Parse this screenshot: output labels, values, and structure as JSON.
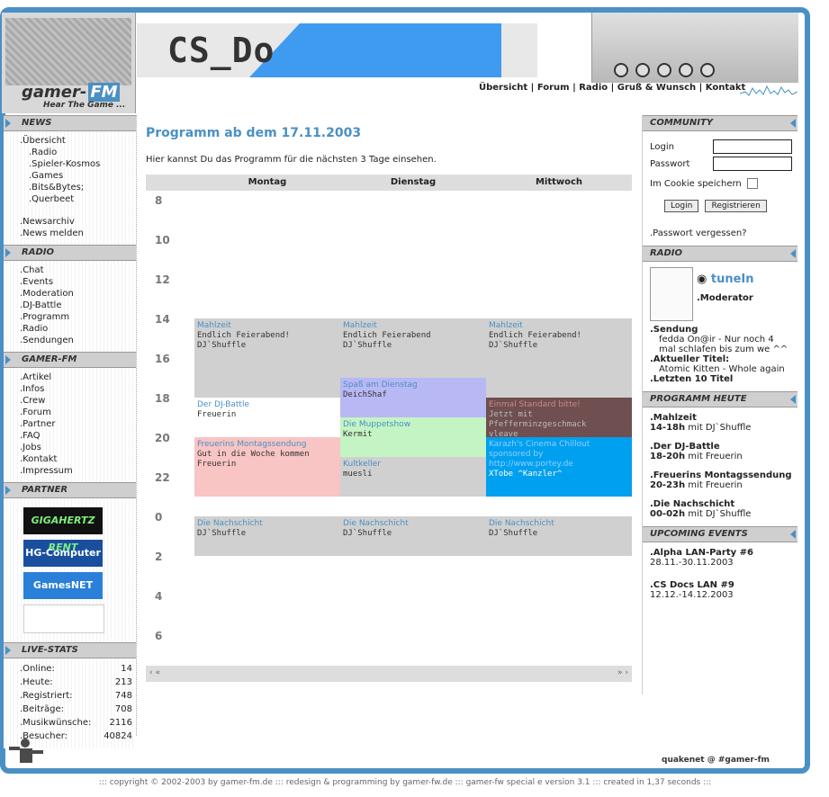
{
  "header": {
    "logo_main": "gamer",
    "logo_fm": "FM",
    "logo_tagline": "Hear The Game ...",
    "banner_text": "CS_Do",
    "nav": [
      "Übersicht",
      "Forum",
      "Radio",
      "Gruß & Wunsch",
      "Kontakt"
    ]
  },
  "left": {
    "news": {
      "title": "NEWS",
      "items": [
        ".Übersicht"
      ],
      "sub": [
        ".Radio",
        ".Spieler-Kosmos",
        ".Games",
        ".Bits&Bytes;",
        ".Querbeet"
      ],
      "extra": [
        ".Newsarchiv",
        ".News melden"
      ]
    },
    "radio": {
      "title": "RADIO",
      "items": [
        ".Chat",
        ".Events",
        ".Moderation",
        ".DJ-Battle",
        ".Programm",
        ".Radio",
        ".Sendungen"
      ]
    },
    "gamerfm": {
      "title": "GAMER-FM",
      "items": [
        ".Artikel",
        ".Infos",
        ".Crew",
        ".Forum",
        ".Partner",
        ".FAQ",
        ".Jobs",
        ".Kontakt",
        ".Impressum"
      ]
    },
    "partner": {
      "title": "PARTNER",
      "logos": [
        "GIGAHERTZ RENT",
        "HG-Computer",
        "GamesNET"
      ]
    },
    "stats": {
      "title": "LIVE-STATS",
      "rows": [
        {
          "label": ".Online:",
          "value": "14"
        },
        {
          "label": ".Heute:",
          "value": "213"
        },
        {
          "label": ".Registriert:",
          "value": "748"
        },
        {
          "label": ".Beiträge:",
          "value": "708"
        },
        {
          "label": ".Musikwünsche:",
          "value": "2116"
        },
        {
          "label": ".Besucher:",
          "value": "40824"
        }
      ]
    }
  },
  "main": {
    "title": "Programm ab dem 17.11.2003",
    "intro": "Hier kannst Du das Programm für die nächsten 3 Tage einsehen.",
    "days": [
      "Montag",
      "Dienstag",
      "Mittwoch"
    ],
    "hours": [
      "8",
      "10",
      "12",
      "14",
      "16",
      "18",
      "20",
      "22",
      "0",
      "2",
      "4",
      "6"
    ],
    "slots": [
      {
        "title": "Mahlzeit",
        "desc": "Endlich Feierabend!\nDJ`Shuffle",
        "day": 0,
        "start": 14,
        "end": 18,
        "color": "#d0d0d0"
      },
      {
        "title": "Mahlzeit",
        "desc": "Endlich Feierabend\nDJ`Shuffle",
        "day": 1,
        "start": 14,
        "end": 17,
        "color": "#d0d0d0"
      },
      {
        "title": "Mahlzeit",
        "desc": "Endlich Feierabend!\nDJ`Shuffle",
        "day": 2,
        "start": 14,
        "end": 18,
        "color": "#d0d0d0"
      },
      {
        "title": "Der DJ-Battle",
        "desc": "Freuerin",
        "day": 0,
        "start": 18,
        "end": 20,
        "color": "#ffffff"
      },
      {
        "title": "Spaß am Dienstag",
        "desc": "DeichShaf",
        "day": 1,
        "start": 17,
        "end": 19,
        "color": "#b8b8f4"
      },
      {
        "title": "Einmal Standard bitte!",
        "desc": "Jetzt mit Pfefferminzgeschmack\nvleave",
        "day": 2,
        "start": 18,
        "end": 20,
        "color": "#6f4f4f"
      },
      {
        "title": "Die Muppetshow",
        "desc": "Kermit",
        "day": 1,
        "start": 19,
        "end": 21,
        "color": "#c4f4c4"
      },
      {
        "title": "Freuerins Montagssendung",
        "desc": "Gut in die Woche kommen\nFreuerin",
        "day": 0,
        "start": 20,
        "end": 23,
        "color": "#f8c4c4"
      },
      {
        "title": "Kultkeller",
        "desc": "muesli",
        "day": 1,
        "start": 21,
        "end": 23,
        "color": "#d0d0d0"
      },
      {
        "title": "Karazh's Cinema Chillout sponsored by http://www.portey.de",
        "desc": "XTobe ^Kanzler^",
        "day": 2,
        "start": 20,
        "end": 23,
        "color": "#00a0f0"
      },
      {
        "title": "Die Nachschicht",
        "desc": "DJ`Shuffle",
        "day": 0,
        "start": 24,
        "end": 26,
        "color": "#d0d0d0"
      },
      {
        "title": "Die Nachschicht",
        "desc": "DJ`Shuffle",
        "day": 1,
        "start": 24,
        "end": 26,
        "color": "#d0d0d0"
      },
      {
        "title": "Die Nachschicht",
        "desc": "DJ`Shuffle",
        "day": 2,
        "start": 24,
        "end": 26,
        "color": "#d0d0d0"
      }
    ],
    "scroll_left": "‹ «",
    "scroll_right": "» ›"
  },
  "right": {
    "community": {
      "title": "COMMUNITY",
      "login_label": "Login",
      "password_label": "Passwort",
      "cookie_label": "Im Cookie speichern",
      "login_button": "Login",
      "register_button": "Registrieren",
      "forgot": ".Passwort vergessen?"
    },
    "radio": {
      "title": "RADIO",
      "tunein": "tuneIn",
      "moderator": ".Moderator",
      "sendung_label": ".Sendung",
      "sendung_text": "fedda On@ir - Nur noch 4 mal schlafen bis zum we ^^",
      "titel_label": ".Aktueller Titel:",
      "titel_text": "Atomic Kitten - Whole again",
      "last10": ".Letzten 10 Titel"
    },
    "today": {
      "title": "PROGRAMM HEUTE",
      "items": [
        {
          "name": ".Mahlzeit",
          "time": "14-18h",
          "by": "mit DJ`Shuffle"
        },
        {
          "name": ".Der DJ-Battle",
          "time": "18-20h",
          "by": "mit Freuerin"
        },
        {
          "name": ".Freuerins Montagssendung",
          "time": "20-23h",
          "by": "mit Freuerin"
        },
        {
          "name": ".Die Nachschicht",
          "time": "00-02h",
          "by": "mit DJ`Shuffle"
        }
      ]
    },
    "events": {
      "title": "UPCOMING EVENTS",
      "items": [
        {
          "name": ".Alpha LAN-Party #6",
          "date": "28.11.-30.11.2003"
        },
        {
          "name": ".CS Docs LAN #9",
          "date": "12.12.-14.12.2003"
        }
      ]
    }
  },
  "footer": {
    "user": "quakenet @ #gamer-fm",
    "copyright": "::: copyright © 2002-2003 by gamer-fm.de ::: redesign & programming by gamer-fw.de ::: gamer-fw special e version 3.1 ::: created in 1,37 seconds :::"
  },
  "colors": {
    "accent": "#4a90c4",
    "frame": "#4a90c4",
    "section": "#cfcfcf"
  }
}
